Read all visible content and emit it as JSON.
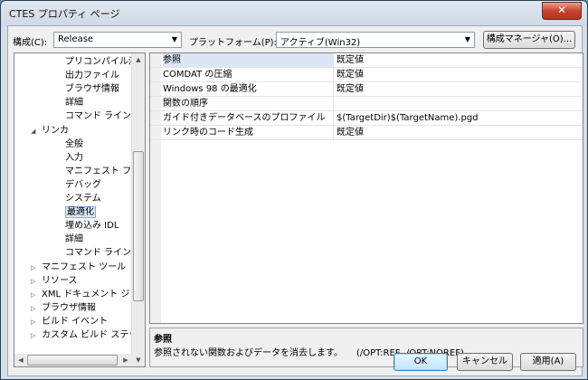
{
  "window": {
    "title": "CTES プロパティ ページ",
    "close_glyph": "✕"
  },
  "toolbar": {
    "config_label": "構成(C):",
    "config_value": "Release",
    "platform_label": "プラットフォーム(P):",
    "platform_value": "アクティブ(Win32)",
    "config_manager_label": "構成マネージャ(O)..."
  },
  "tree": {
    "items": [
      {
        "label": "プリコンパイル済み",
        "exp": ""
      },
      {
        "label": "出力ファイル",
        "exp": ""
      },
      {
        "label": "ブラウザ情報",
        "exp": ""
      },
      {
        "label": "詳細",
        "exp": ""
      },
      {
        "label": "コマンド ライン",
        "exp": ""
      },
      {
        "label": "リンカ",
        "exp": "◢"
      },
      {
        "label": "全般",
        "exp": ""
      },
      {
        "label": "入力",
        "exp": ""
      },
      {
        "label": "マニフェスト ファイ",
        "exp": ""
      },
      {
        "label": "デバッグ",
        "exp": ""
      },
      {
        "label": "システム",
        "exp": ""
      },
      {
        "label": "最適化",
        "exp": ""
      },
      {
        "label": "埋め込み IDL",
        "exp": ""
      },
      {
        "label": "詳細",
        "exp": ""
      },
      {
        "label": "コマンド ライン",
        "exp": ""
      },
      {
        "label": "マニフェスト ツール",
        "exp": "▷"
      },
      {
        "label": "リソース",
        "exp": "▷"
      },
      {
        "label": "XML ドキュメント ジェ",
        "exp": "▷"
      },
      {
        "label": "ブラウザ情報",
        "exp": "▷"
      },
      {
        "label": "ビルド イベント",
        "exp": "▷"
      },
      {
        "label": "カスタム ビルド ステッ",
        "exp": "▷"
      }
    ]
  },
  "grid": {
    "rows": [
      {
        "name": "参照",
        "value": "既定値"
      },
      {
        "name": "COMDAT の圧縮",
        "value": "既定値"
      },
      {
        "name": "Windows 98 の最適化",
        "value": "既定値"
      },
      {
        "name": "関数の順序",
        "value": ""
      },
      {
        "name": "ガイド付きデータベースのプロファイル",
        "value": "$(TargetDir)$(TargetName).pgd"
      },
      {
        "name": "リンク時のコード生成",
        "value": "既定値"
      }
    ]
  },
  "description": {
    "title": "参照",
    "text": "参照されない関数およびデータを消去します。　　(/OPT:REF, /OPT:NOREF)"
  },
  "buttons": {
    "ok": "OK",
    "cancel": "キャンセル",
    "apply": "適用(A)"
  },
  "icons": {
    "collapse": "◢",
    "expand": "▷",
    "dropdown": "▼",
    "scroll_up": "▲",
    "scroll_down": "▼",
    "scroll_left": "◀",
    "scroll_right": "▶"
  }
}
